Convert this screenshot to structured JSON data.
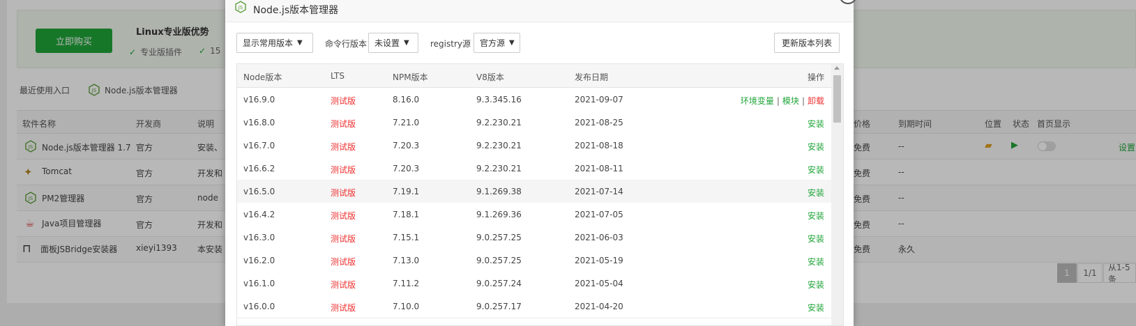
{
  "promo": {
    "buy_label": "立即购买",
    "title": "Linux专业版优势",
    "features": [
      "专业版插件",
      "15"
    ]
  },
  "recent": {
    "label": "最近使用入口",
    "item": "Node.js版本管理器"
  },
  "software_table": {
    "headers": [
      "软件名称",
      "开发商",
      "说明",
      "价格",
      "到期时间",
      "位置",
      "状态",
      "首页显示"
    ],
    "rows": [
      {
        "name": "Node.js版本管理器 1.7",
        "dev": "官方",
        "desc": "安装、",
        "price": "免费",
        "expire": "--",
        "action": "设置"
      },
      {
        "name": "Tomcat",
        "dev": "官方",
        "desc": "开发和",
        "price": "免费",
        "expire": "--"
      },
      {
        "name": "PM2管理器",
        "dev": "官方",
        "desc": "node",
        "price": "免费",
        "expire": "--"
      },
      {
        "name": "Java项目管理器",
        "dev": "官方",
        "desc": "开发和",
        "price": "免费",
        "expire": "--"
      },
      {
        "name": "面板JSBridge安装器",
        "dev": "xieyi1393",
        "desc": "本安装",
        "price": "免费",
        "expire": "永久"
      }
    ]
  },
  "pagination": {
    "current": "1",
    "total": "1/1",
    "range": "从1-5条"
  },
  "modal": {
    "title": "Node.js版本管理器",
    "filter_select": "显示常用版本",
    "cli_label": "命令行版本",
    "cli_select": "未设置",
    "registry_label": "registry源",
    "registry_select": "官方源",
    "refresh_label": "更新版本列表",
    "headers": {
      "node": "Node版本",
      "lts": "LTS",
      "npm": "NPM版本",
      "v8": "V8版本",
      "date": "发布日期",
      "op": "操作"
    },
    "rows": [
      {
        "node": "v16.9.0",
        "lts": "测试版",
        "npm": "8.16.0",
        "v8": "9.3.345.16",
        "date": "2021-09-07",
        "installed": true
      },
      {
        "node": "v16.8.0",
        "lts": "测试版",
        "npm": "7.21.0",
        "v8": "9.2.230.21",
        "date": "2021-08-25"
      },
      {
        "node": "v16.7.0",
        "lts": "测试版",
        "npm": "7.20.3",
        "v8": "9.2.230.21",
        "date": "2021-08-18"
      },
      {
        "node": "v16.6.2",
        "lts": "测试版",
        "npm": "7.20.3",
        "v8": "9.2.230.21",
        "date": "2021-08-11"
      },
      {
        "node": "v16.5.0",
        "lts": "测试版",
        "npm": "7.19.1",
        "v8": "9.1.269.38",
        "date": "2021-07-14"
      },
      {
        "node": "v16.4.2",
        "lts": "测试版",
        "npm": "7.18.1",
        "v8": "9.1.269.36",
        "date": "2021-07-05"
      },
      {
        "node": "v16.3.0",
        "lts": "测试版",
        "npm": "7.15.1",
        "v8": "9.0.257.25",
        "date": "2021-06-03"
      },
      {
        "node": "v16.2.0",
        "lts": "测试版",
        "npm": "7.13.0",
        "v8": "9.0.257.25",
        "date": "2021-05-19"
      },
      {
        "node": "v16.1.0",
        "lts": "测试版",
        "npm": "7.11.2",
        "v8": "9.0.257.24",
        "date": "2021-05-04"
      },
      {
        "node": "v16.0.0",
        "lts": "测试版",
        "npm": "7.10.0",
        "v8": "9.0.257.17",
        "date": "2021-04-20"
      }
    ],
    "actions": {
      "env": "环境变量",
      "module": "模块",
      "uninstall": "卸载",
      "install": "安装"
    }
  },
  "colors": {
    "accent_green": "#20a53a",
    "danger_red": "#ee3030"
  }
}
